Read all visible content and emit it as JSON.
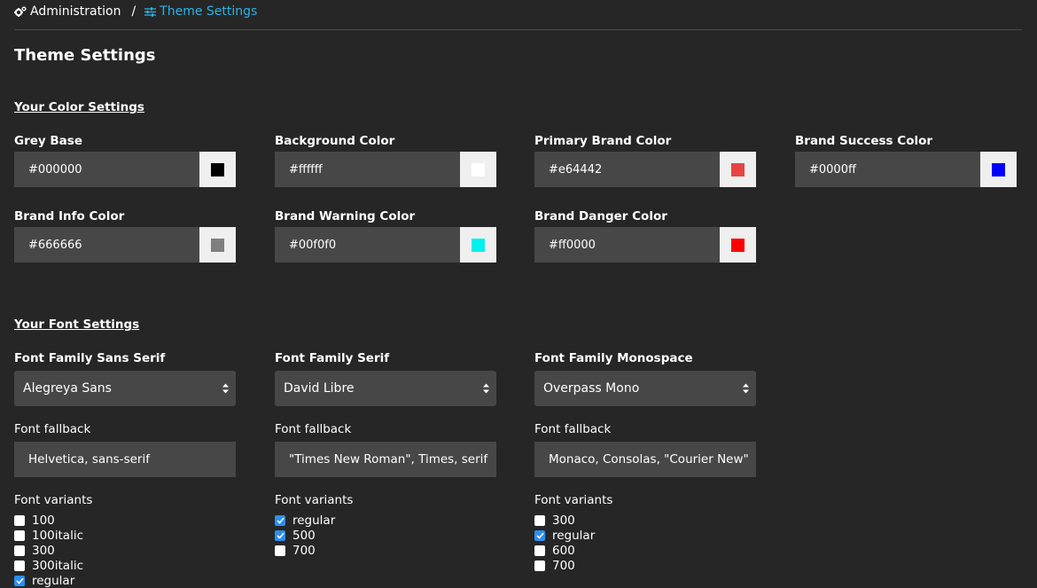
{
  "breadcrumb": {
    "admin_label": "Administration",
    "separator": "/",
    "current_label": "Theme Settings"
  },
  "page_title": "Theme Settings",
  "color_section": {
    "title": "Your Color Settings",
    "fields": [
      {
        "label": "Grey Base",
        "value": "#000000",
        "swatch": "#000000"
      },
      {
        "label": "Background Color",
        "value": "#ffffff",
        "swatch": "#ffffff"
      },
      {
        "label": "Primary Brand Color",
        "value": "#e64442",
        "swatch": "#e64442"
      },
      {
        "label": "Brand Success Color",
        "value": "#0000ff",
        "swatch": "#0000ff"
      },
      {
        "label": "Brand Info Color",
        "value": "#666666",
        "swatch": "#7f7f7f"
      },
      {
        "label": "Brand Warning Color",
        "value": "#00f0f0",
        "swatch": "#00f0f0"
      },
      {
        "label": "Brand Danger Color",
        "value": "#ff0000",
        "swatch": "#ff0000"
      }
    ]
  },
  "font_section": {
    "title": "Your Font Settings",
    "fallback_label": "Font fallback",
    "variants_label": "Font variants",
    "families": [
      {
        "label": "Font Family Sans Serif",
        "selected": "Alegreya Sans",
        "fallback": "Helvetica, sans-serif",
        "variants": [
          {
            "name": "100",
            "checked": false
          },
          {
            "name": "100italic",
            "checked": false
          },
          {
            "name": "300",
            "checked": false
          },
          {
            "name": "300italic",
            "checked": false
          },
          {
            "name": "regular",
            "checked": true
          }
        ]
      },
      {
        "label": "Font Family Serif",
        "selected": "David Libre",
        "fallback": "\"Times New Roman\", Times, serif",
        "variants": [
          {
            "name": "regular",
            "checked": true
          },
          {
            "name": "500",
            "checked": true
          },
          {
            "name": "700",
            "checked": false
          }
        ]
      },
      {
        "label": "Font Family Monospace",
        "selected": "Overpass Mono",
        "fallback": "Monaco, Consolas, \"Courier New\"",
        "variants": [
          {
            "name": "300",
            "checked": false
          },
          {
            "name": "regular",
            "checked": true
          },
          {
            "name": "600",
            "checked": false
          },
          {
            "name": "700",
            "checked": false
          }
        ]
      }
    ]
  },
  "colors": {
    "background": "#262626",
    "input_bg": "#474747",
    "accent": "#2bb3e6",
    "checkbox_checked": "#2c8ff0"
  }
}
